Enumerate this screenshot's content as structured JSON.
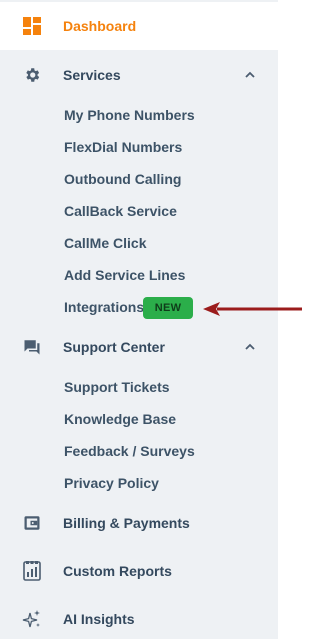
{
  "nav": {
    "dashboard": {
      "label": "Dashboard",
      "icon": "dashboard-icon"
    },
    "services": {
      "label": "Services",
      "icon": "gear-icon",
      "expanded": true,
      "items": [
        {
          "label": "My Phone Numbers"
        },
        {
          "label": "FlexDial Numbers"
        },
        {
          "label": "Outbound Calling"
        },
        {
          "label": "CallBack Service"
        },
        {
          "label": "CallMe Click"
        },
        {
          "label": "Add Service Lines"
        },
        {
          "label": "Integrations",
          "badge": "NEW"
        }
      ]
    },
    "support_center": {
      "label": "Support Center",
      "icon": "chat-icon",
      "expanded": true,
      "items": [
        {
          "label": "Support Tickets"
        },
        {
          "label": "Knowledge Base"
        },
        {
          "label": "Feedback / Surveys"
        },
        {
          "label": "Privacy Policy"
        }
      ]
    },
    "billing": {
      "label": "Billing & Payments",
      "icon": "wallet-icon"
    },
    "reports": {
      "label": "Custom Reports",
      "icon": "report-icon"
    },
    "insights": {
      "label": "AI Insights",
      "icon": "sparkle-icon"
    }
  },
  "colors": {
    "accent": "#f5820d",
    "sidebar_bg": "#eef1f4",
    "text": "#34495e",
    "badge_bg": "#2bae4a",
    "arrow": "#9b1c1c"
  }
}
